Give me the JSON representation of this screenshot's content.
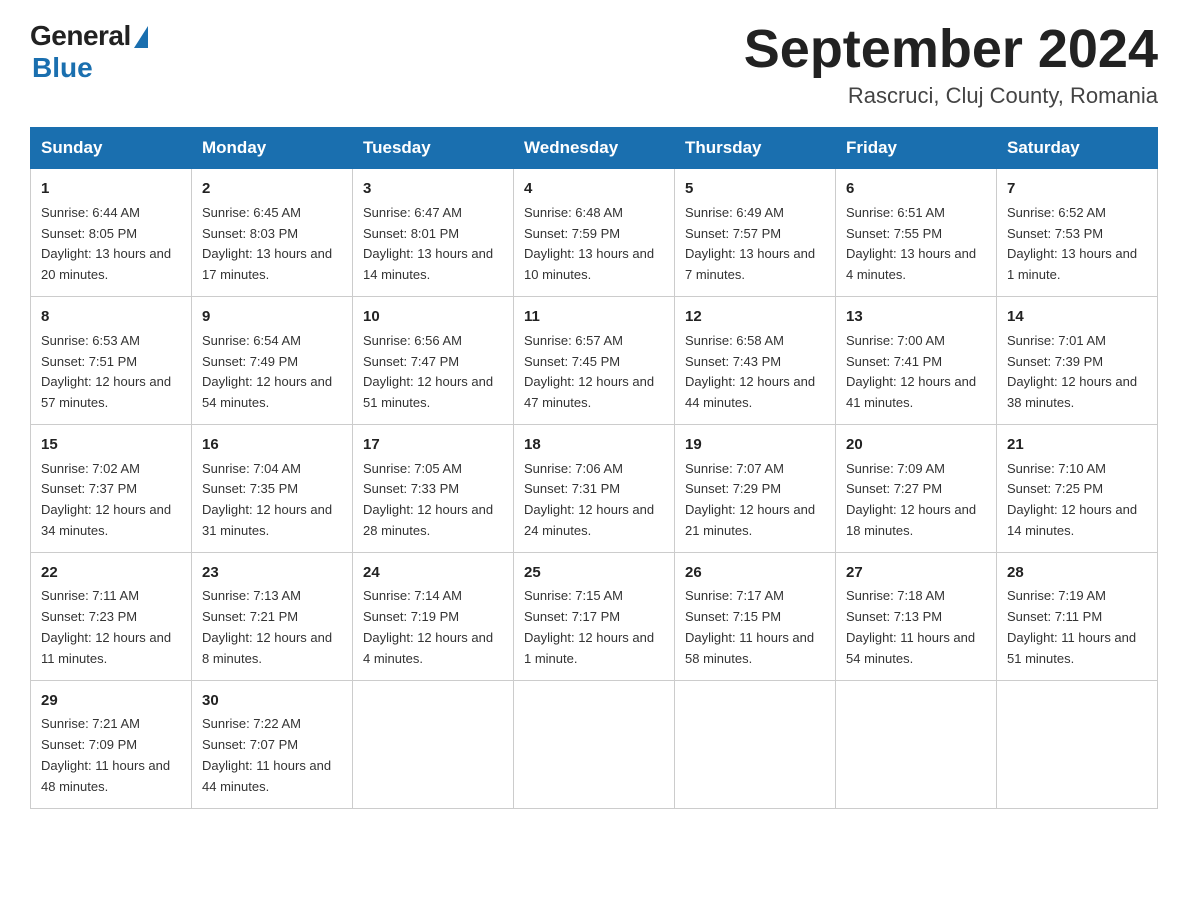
{
  "logo": {
    "general": "General",
    "blue": "Blue"
  },
  "title": "September 2024",
  "location": "Rascruci, Cluj County, Romania",
  "days_of_week": [
    "Sunday",
    "Monday",
    "Tuesday",
    "Wednesday",
    "Thursday",
    "Friday",
    "Saturday"
  ],
  "weeks": [
    [
      {
        "day": "1",
        "sunrise": "6:44 AM",
        "sunset": "8:05 PM",
        "daylight": "13 hours and 20 minutes."
      },
      {
        "day": "2",
        "sunrise": "6:45 AM",
        "sunset": "8:03 PM",
        "daylight": "13 hours and 17 minutes."
      },
      {
        "day": "3",
        "sunrise": "6:47 AM",
        "sunset": "8:01 PM",
        "daylight": "13 hours and 14 minutes."
      },
      {
        "day": "4",
        "sunrise": "6:48 AM",
        "sunset": "7:59 PM",
        "daylight": "13 hours and 10 minutes."
      },
      {
        "day": "5",
        "sunrise": "6:49 AM",
        "sunset": "7:57 PM",
        "daylight": "13 hours and 7 minutes."
      },
      {
        "day": "6",
        "sunrise": "6:51 AM",
        "sunset": "7:55 PM",
        "daylight": "13 hours and 4 minutes."
      },
      {
        "day": "7",
        "sunrise": "6:52 AM",
        "sunset": "7:53 PM",
        "daylight": "13 hours and 1 minute."
      }
    ],
    [
      {
        "day": "8",
        "sunrise": "6:53 AM",
        "sunset": "7:51 PM",
        "daylight": "12 hours and 57 minutes."
      },
      {
        "day": "9",
        "sunrise": "6:54 AM",
        "sunset": "7:49 PM",
        "daylight": "12 hours and 54 minutes."
      },
      {
        "day": "10",
        "sunrise": "6:56 AM",
        "sunset": "7:47 PM",
        "daylight": "12 hours and 51 minutes."
      },
      {
        "day": "11",
        "sunrise": "6:57 AM",
        "sunset": "7:45 PM",
        "daylight": "12 hours and 47 minutes."
      },
      {
        "day": "12",
        "sunrise": "6:58 AM",
        "sunset": "7:43 PM",
        "daylight": "12 hours and 44 minutes."
      },
      {
        "day": "13",
        "sunrise": "7:00 AM",
        "sunset": "7:41 PM",
        "daylight": "12 hours and 41 minutes."
      },
      {
        "day": "14",
        "sunrise": "7:01 AM",
        "sunset": "7:39 PM",
        "daylight": "12 hours and 38 minutes."
      }
    ],
    [
      {
        "day": "15",
        "sunrise": "7:02 AM",
        "sunset": "7:37 PM",
        "daylight": "12 hours and 34 minutes."
      },
      {
        "day": "16",
        "sunrise": "7:04 AM",
        "sunset": "7:35 PM",
        "daylight": "12 hours and 31 minutes."
      },
      {
        "day": "17",
        "sunrise": "7:05 AM",
        "sunset": "7:33 PM",
        "daylight": "12 hours and 28 minutes."
      },
      {
        "day": "18",
        "sunrise": "7:06 AM",
        "sunset": "7:31 PM",
        "daylight": "12 hours and 24 minutes."
      },
      {
        "day": "19",
        "sunrise": "7:07 AM",
        "sunset": "7:29 PM",
        "daylight": "12 hours and 21 minutes."
      },
      {
        "day": "20",
        "sunrise": "7:09 AM",
        "sunset": "7:27 PM",
        "daylight": "12 hours and 18 minutes."
      },
      {
        "day": "21",
        "sunrise": "7:10 AM",
        "sunset": "7:25 PM",
        "daylight": "12 hours and 14 minutes."
      }
    ],
    [
      {
        "day": "22",
        "sunrise": "7:11 AM",
        "sunset": "7:23 PM",
        "daylight": "12 hours and 11 minutes."
      },
      {
        "day": "23",
        "sunrise": "7:13 AM",
        "sunset": "7:21 PM",
        "daylight": "12 hours and 8 minutes."
      },
      {
        "day": "24",
        "sunrise": "7:14 AM",
        "sunset": "7:19 PM",
        "daylight": "12 hours and 4 minutes."
      },
      {
        "day": "25",
        "sunrise": "7:15 AM",
        "sunset": "7:17 PM",
        "daylight": "12 hours and 1 minute."
      },
      {
        "day": "26",
        "sunrise": "7:17 AM",
        "sunset": "7:15 PM",
        "daylight": "11 hours and 58 minutes."
      },
      {
        "day": "27",
        "sunrise": "7:18 AM",
        "sunset": "7:13 PM",
        "daylight": "11 hours and 54 minutes."
      },
      {
        "day": "28",
        "sunrise": "7:19 AM",
        "sunset": "7:11 PM",
        "daylight": "11 hours and 51 minutes."
      }
    ],
    [
      {
        "day": "29",
        "sunrise": "7:21 AM",
        "sunset": "7:09 PM",
        "daylight": "11 hours and 48 minutes."
      },
      {
        "day": "30",
        "sunrise": "7:22 AM",
        "sunset": "7:07 PM",
        "daylight": "11 hours and 44 minutes."
      },
      null,
      null,
      null,
      null,
      null
    ]
  ]
}
